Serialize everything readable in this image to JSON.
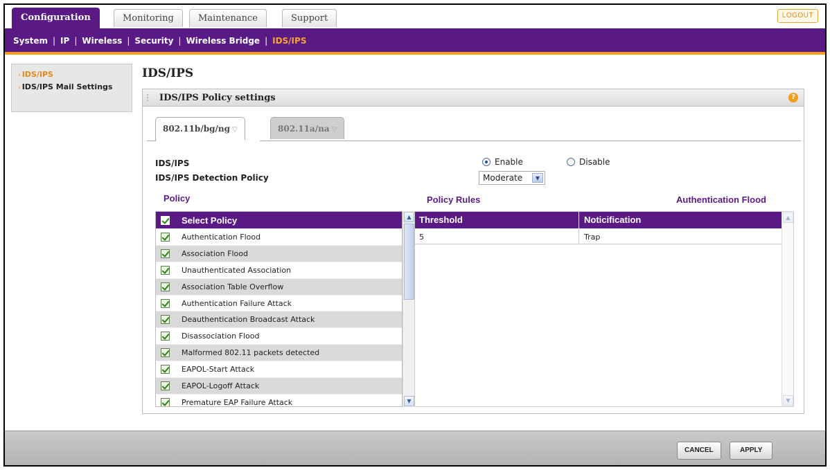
{
  "top_tabs": [
    {
      "label": "Configuration",
      "active": true
    },
    {
      "label": "Monitoring",
      "active": false
    },
    {
      "label": "Maintenance",
      "active": false
    },
    {
      "label": "Support",
      "active": false
    }
  ],
  "logout_label": "LOGOUT",
  "subnav": [
    {
      "label": "System",
      "active": false
    },
    {
      "label": "IP",
      "active": false
    },
    {
      "label": "Wireless",
      "active": false
    },
    {
      "label": "Security",
      "active": false
    },
    {
      "label": "Wireless Bridge",
      "active": false
    },
    {
      "label": "IDS/IPS",
      "active": true
    }
  ],
  "left_menu": [
    {
      "label": "IDS/IPS",
      "active": true
    },
    {
      "label": "IDS/IPS Mail Settings",
      "active": false
    }
  ],
  "page_title": "IDS/IPS",
  "panel": {
    "title": "IDS/IPS Policy settings",
    "help_icon": "?",
    "band_tabs": [
      {
        "label": "802.11b/bg/ng",
        "active": true
      },
      {
        "label": "802.11a/na",
        "active": false
      }
    ],
    "ids_ips_label": "IDS/IPS",
    "enable_label": "Enable",
    "disable_label": "Disable",
    "enabled": true,
    "detection_policy_label": "IDS/IPS Detection Policy",
    "detection_policy_value": "Moderate",
    "policy_heading": "Policy",
    "policy_rules_heading": "Policy Rules",
    "selected_policy_heading": "Authentication Flood",
    "select_policy_header": "Select Policy",
    "policies": [
      "Authentication Flood",
      "Association Flood",
      "Unauthenticated Association",
      "Association Table Overflow",
      "Authentication Failure Attack",
      "Deauthentication Broadcast Attack",
      "Disassociation Flood",
      "Malformed 802.11 packets detected",
      "EAPOL-Start Attack",
      "EAPOL-Logoff Attack",
      "Premature EAP Failure Attack"
    ],
    "rules_columns": [
      "Threshold",
      "Noticification"
    ],
    "rules_rows": [
      {
        "threshold": "5",
        "notification": "Trap"
      }
    ]
  },
  "buttons": {
    "cancel": "CANCEL",
    "apply": "APPLY"
  },
  "colors": {
    "brand_purple": "#5a1a86",
    "accent_orange": "#f29e1a"
  }
}
